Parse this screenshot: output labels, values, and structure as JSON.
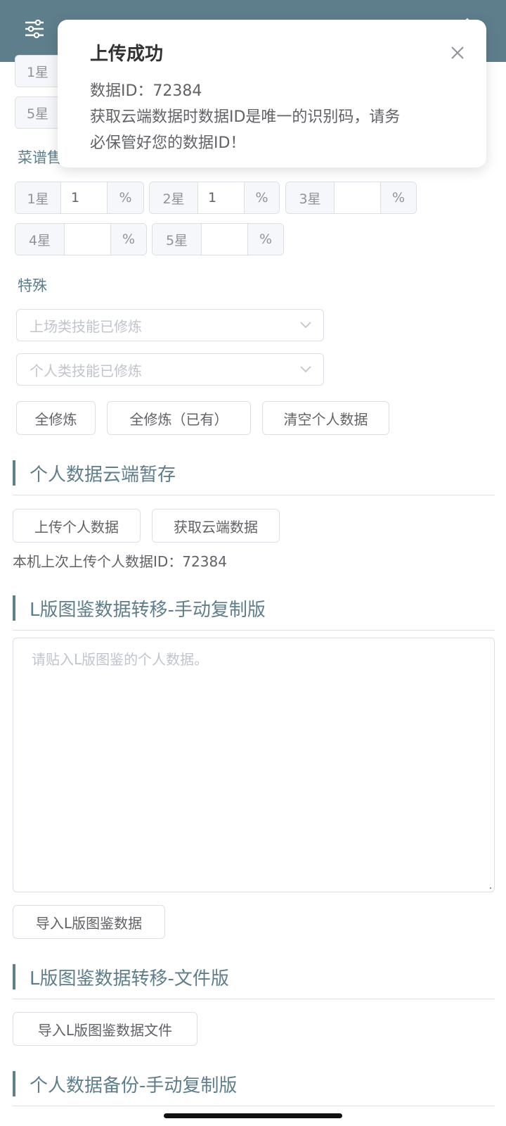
{
  "colors": {
    "accent": "#5f7e8c",
    "border": "#dcdfe6",
    "placeholder": "#c0c4cc"
  },
  "top_rows": [
    {
      "label": "1星"
    },
    {
      "label": "5星"
    }
  ],
  "recipe": {
    "label": "菜谱售",
    "row1": [
      {
        "label": "1星",
        "value": "1",
        "unit": "%"
      },
      {
        "label": "2星",
        "value": "1",
        "unit": "%"
      },
      {
        "label": "3星",
        "value": "",
        "unit": "%"
      }
    ],
    "row2": [
      {
        "label": "4星",
        "value": "",
        "unit": "%"
      },
      {
        "label": "5星",
        "value": "",
        "unit": "%"
      }
    ]
  },
  "special": {
    "label": "特殊",
    "select1_placeholder": "上场类技能已修炼",
    "select2_placeholder": "个人类技能已修炼",
    "btn_all": "全修炼",
    "btn_all_owned": "全修炼（已有）",
    "btn_clear": "清空个人数据"
  },
  "cloud": {
    "title": "个人数据云端暂存",
    "btn_upload": "上传个人数据",
    "btn_fetch": "获取云端数据",
    "last_upload": "本机上次上传个人数据ID：72384"
  },
  "manual": {
    "title": "L版图鉴数据转移-手动复制版",
    "placeholder": "请贴入L版图鉴的个人数据。",
    "btn_import": "导入L版图鉴数据"
  },
  "file": {
    "title": "L版图鉴数据转移-文件版",
    "btn_import_file": "导入L版图鉴数据文件"
  },
  "backup": {
    "title": "个人数据备份-手动复制版"
  },
  "toast": {
    "title": "上传成功",
    "line1": "数据ID：72384",
    "line2": "获取云端数据时数据ID是唯一的识别码，请务",
    "line3": "必保管好您的数据ID！"
  }
}
